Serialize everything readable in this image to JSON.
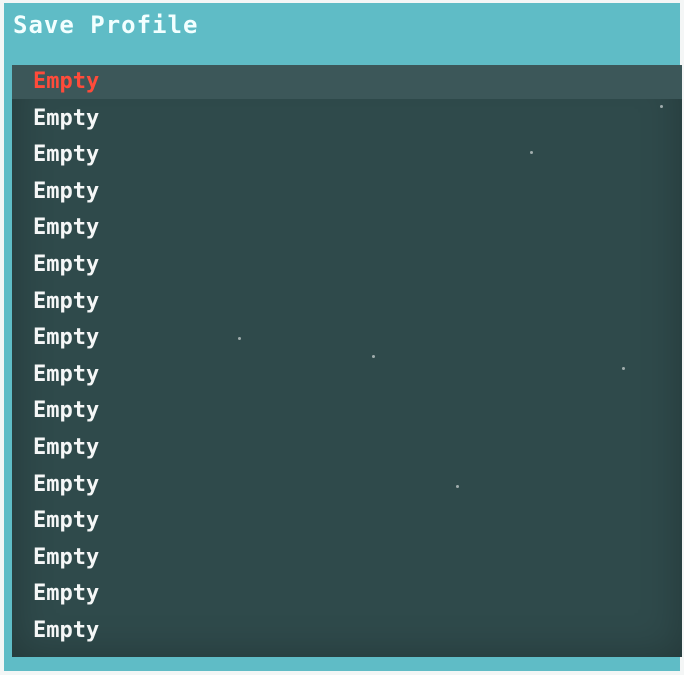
{
  "window": {
    "title": "Save Profile"
  },
  "slots": [
    {
      "label": "Empty",
      "selected": true
    },
    {
      "label": "Empty",
      "selected": false
    },
    {
      "label": "Empty",
      "selected": false
    },
    {
      "label": "Empty",
      "selected": false
    },
    {
      "label": "Empty",
      "selected": false
    },
    {
      "label": "Empty",
      "selected": false
    },
    {
      "label": "Empty",
      "selected": false
    },
    {
      "label": "Empty",
      "selected": false
    },
    {
      "label": "Empty",
      "selected": false
    },
    {
      "label": "Empty",
      "selected": false
    },
    {
      "label": "Empty",
      "selected": false
    },
    {
      "label": "Empty",
      "selected": false
    },
    {
      "label": "Empty",
      "selected": false
    },
    {
      "label": "Empty",
      "selected": false
    },
    {
      "label": "Empty",
      "selected": false
    },
    {
      "label": "Empty",
      "selected": false
    }
  ],
  "colors": {
    "frame": "#5fbcc6",
    "list_background": "#2f4a4b",
    "selected_text": "#ff4b3a",
    "text": "#f5f7f7"
  }
}
